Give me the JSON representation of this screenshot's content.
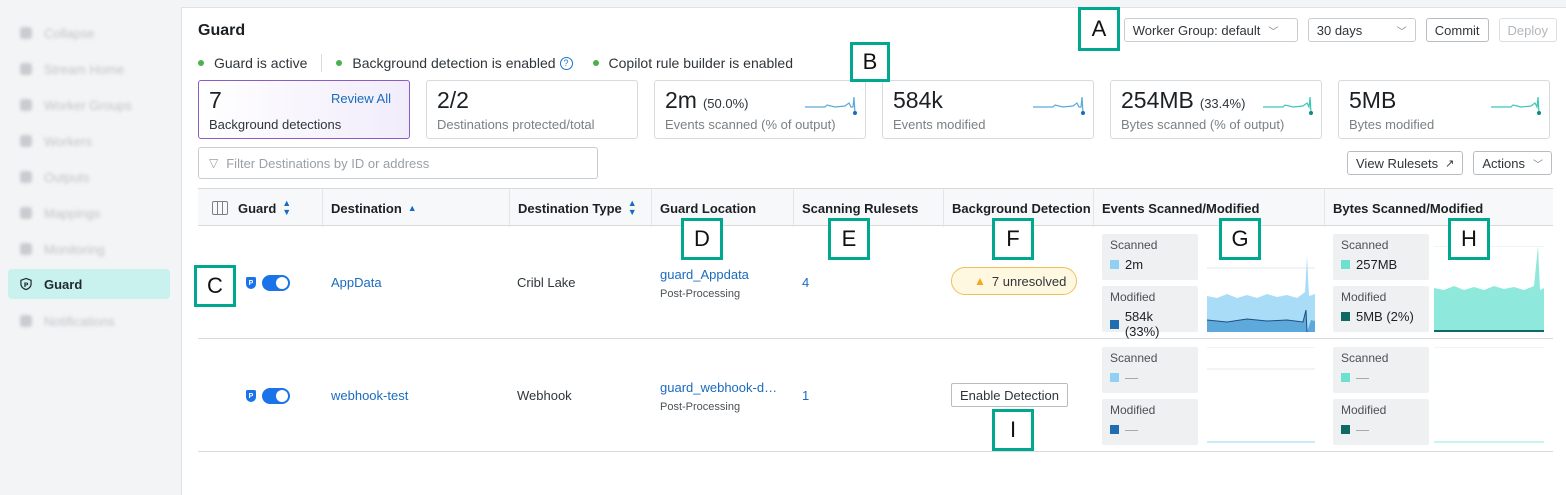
{
  "sidebar": {
    "items": [
      {
        "label": "Collapse"
      },
      {
        "label": "Stream Home"
      },
      {
        "label": "Worker Groups"
      },
      {
        "label": "Workers"
      },
      {
        "label": "Outputs"
      },
      {
        "label": "Mappings"
      },
      {
        "label": "Monitoring"
      },
      {
        "label": "Guard",
        "active": true
      },
      {
        "label": "Notifications"
      }
    ]
  },
  "header": {
    "title": "Guard",
    "statuses": [
      "Guard is active",
      "Background detection is enabled",
      "Copilot rule builder is enabled"
    ],
    "worker_group": "Worker Group: default",
    "time_range": "30 days",
    "commit": "Commit",
    "deploy": "Deploy"
  },
  "cards": [
    {
      "value": "7",
      "label": "Background detections",
      "link": "Review All"
    },
    {
      "value": "2/2",
      "label": "Destinations protected/total"
    },
    {
      "value": "2m",
      "pct": "(50.0%)",
      "label": "Events scanned (% of output)"
    },
    {
      "value": "584k",
      "label": "Events modified"
    },
    {
      "value": "254MB",
      "pct": "(33.4%)",
      "label": "Bytes scanned (% of output)"
    },
    {
      "value": "5MB",
      "label": "Bytes modified"
    }
  ],
  "filter": {
    "placeholder": "Filter Destinations by ID or address"
  },
  "toolbar": {
    "view_rulesets": "View Rulesets",
    "actions": "Actions"
  },
  "table": {
    "columns": [
      "Guard",
      "Destination",
      "Destination Type",
      "Guard Location",
      "Scanning Rulesets",
      "Background Detection",
      "Events Scanned/Modified",
      "Bytes Scanned/Modified"
    ],
    "rows": [
      {
        "destination": "AppData",
        "type": "Cribl Lake",
        "location": "guard_Appdata",
        "location_sub": "Post-Processing",
        "rulesets": "4",
        "detection": "7 unresolved",
        "events_scanned_label": "Scanned",
        "events_scanned": "2m",
        "events_modified_label": "Modified",
        "events_modified": "584k (33%)",
        "bytes_scanned_label": "Scanned",
        "bytes_scanned": "257MB",
        "bytes_modified_label": "Modified",
        "bytes_modified": "5MB (2%)"
      },
      {
        "destination": "webhook-test",
        "type": "Webhook",
        "location": "guard_webhook-d…",
        "location_sub": "Post-Processing",
        "rulesets": "1",
        "detection": "Enable Detection",
        "events_scanned_label": "Scanned",
        "events_scanned": "—",
        "events_modified_label": "Modified",
        "events_modified": "—",
        "bytes_scanned_label": "Scanned",
        "bytes_scanned": "—",
        "bytes_modified_label": "Modified",
        "bytes_modified": "—"
      }
    ]
  },
  "markers": [
    "A",
    "B",
    "C",
    "D",
    "E",
    "F",
    "G",
    "H",
    "I"
  ],
  "colors": {
    "accent": "#00a88f",
    "link": "#1a6bbf",
    "scanned_light": "#8fd0f5",
    "modified_dark": "#1f6fb0",
    "bytes_light": "#6ee0d0",
    "bytes_dark": "#0e6b64"
  }
}
